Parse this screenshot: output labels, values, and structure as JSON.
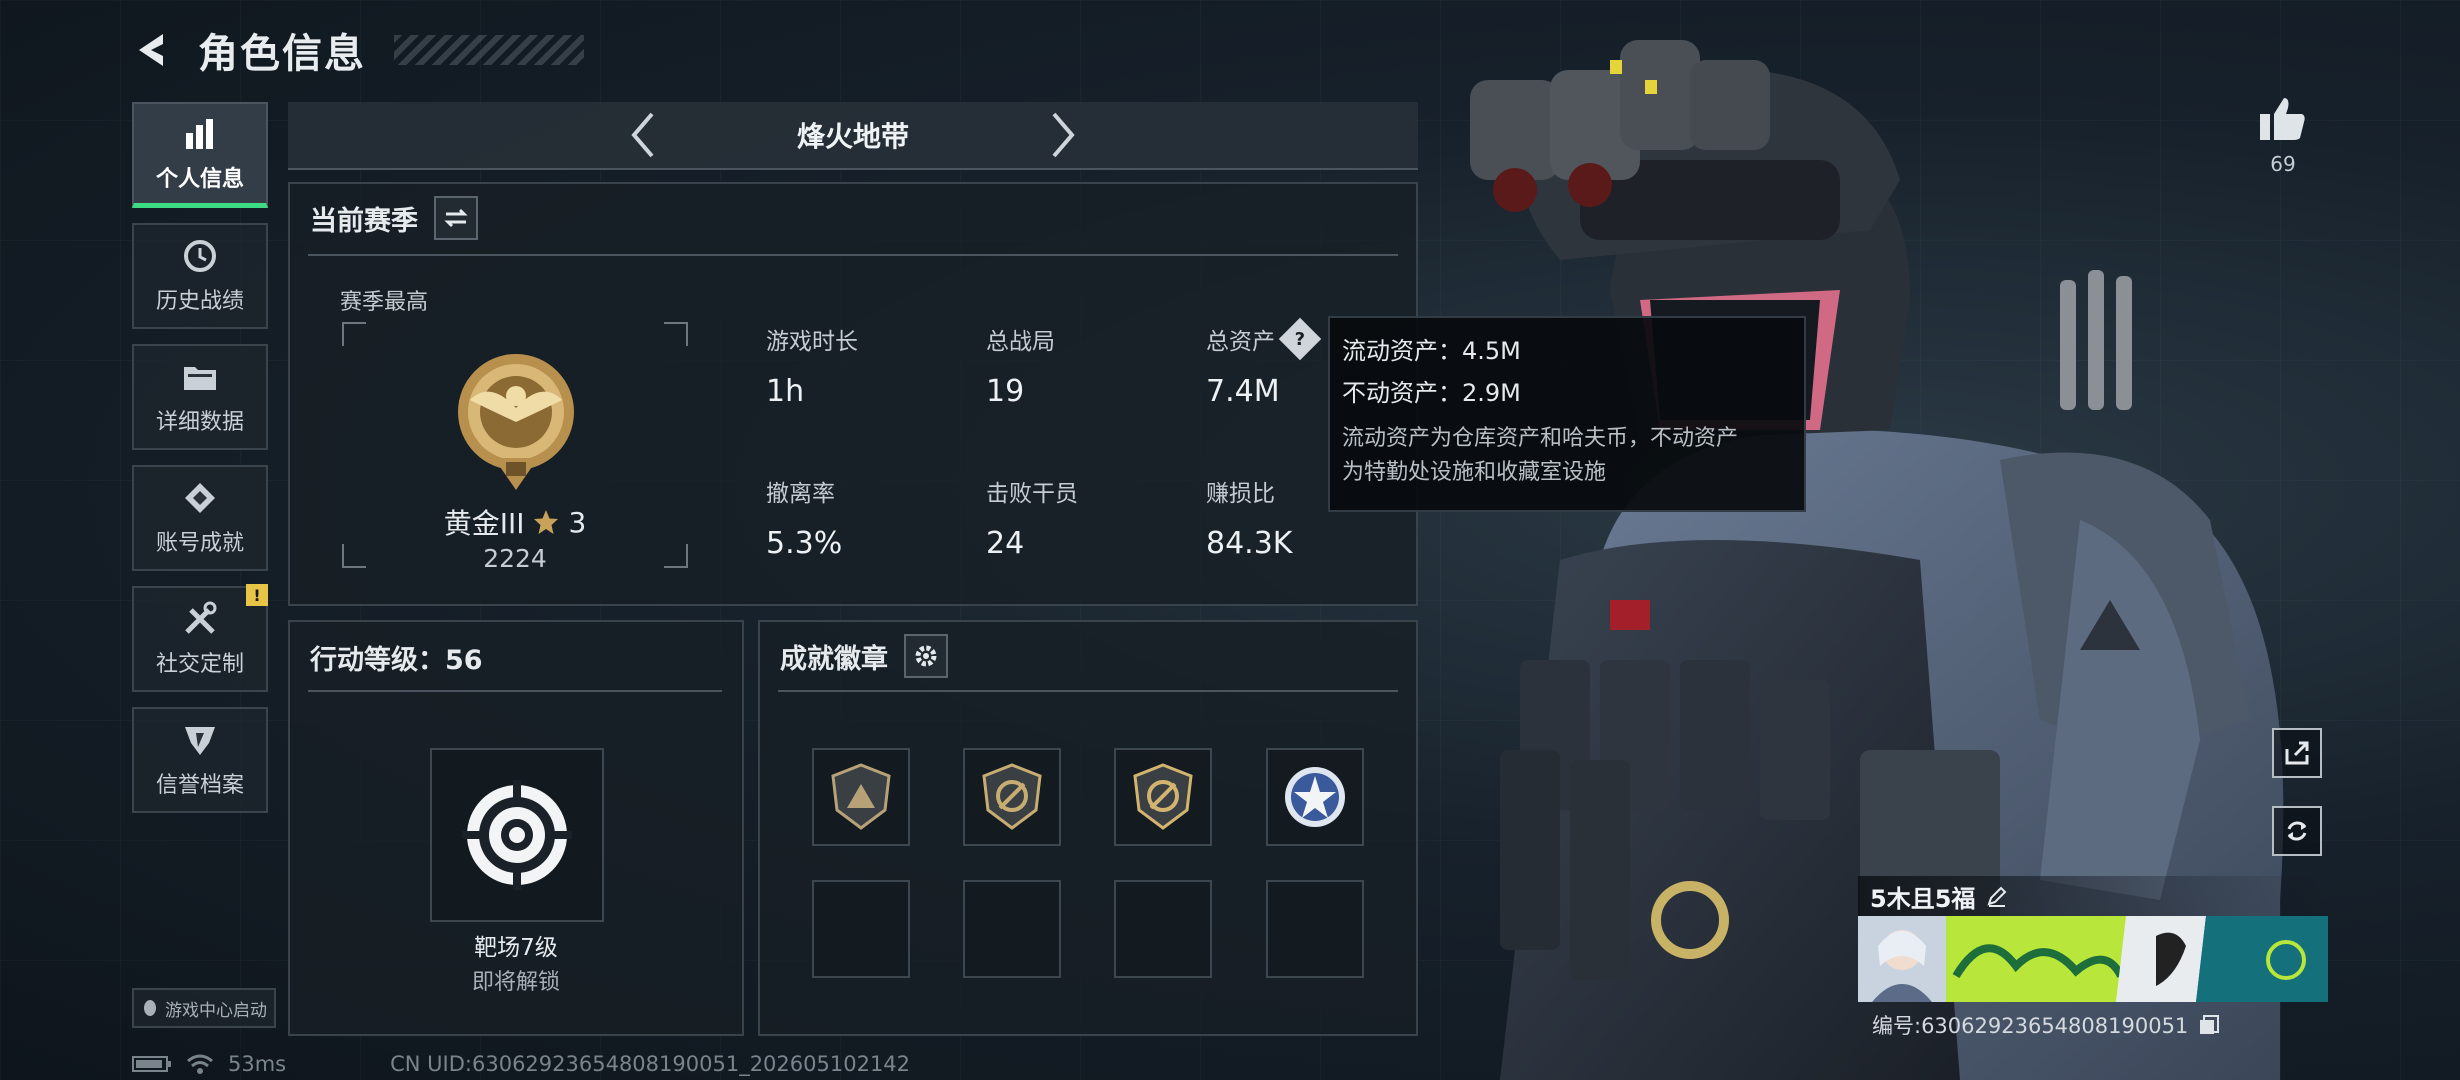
{
  "header": {
    "title": "角色信息"
  },
  "sidebar": {
    "items": [
      {
        "label": "个人信息",
        "icon": "bar-chart-icon",
        "active": true
      },
      {
        "label": "历史战绩",
        "icon": "history-icon"
      },
      {
        "label": "详细数据",
        "icon": "folder-icon"
      },
      {
        "label": "账号成就",
        "icon": "achievement-icon"
      },
      {
        "label": "社交定制",
        "icon": "tools-icon",
        "badge": "!"
      },
      {
        "label": "信誉档案",
        "icon": "credit-icon"
      }
    ],
    "game_center_label": "游戏中心启动"
  },
  "mode": {
    "title": "烽火地带"
  },
  "season": {
    "title": "当前赛季",
    "best_label": "赛季最高",
    "rank_name": "黄金III",
    "rank_stars": "3",
    "rank_score": "2224",
    "stats": [
      {
        "label": "游戏时长",
        "value": "1h"
      },
      {
        "label": "总战局",
        "value": "19"
      },
      {
        "label": "总资产",
        "value": "7.4M"
      },
      {
        "label": "撤离率",
        "value": "5.3%"
      },
      {
        "label": "击败干员",
        "value": "24"
      },
      {
        "label": "赚损比",
        "value": "84.3K"
      }
    ]
  },
  "tooltip": {
    "liquid": "流动资产：4.5M",
    "fixed": "不动资产：2.9M",
    "desc_line1": "流动资产为仓库资产和哈夫币，不动资产",
    "desc_line2": "为特勤处设施和收藏室设施"
  },
  "level": {
    "title": "行动等级：56",
    "item_name": "靶场7级",
    "item_status": "即将解锁"
  },
  "badges": {
    "title": "成就徽章"
  },
  "player": {
    "likes": "69",
    "name": "5木且5福",
    "uid": "编号:6306292365480819​0051"
  },
  "footer": {
    "ping": "53ms",
    "uid": "CN UID:6306292365480819​0051_202605102142"
  },
  "colors": {
    "accent": "#3ddc84",
    "warning": "#e8c547",
    "gold": "#c9a25a"
  }
}
